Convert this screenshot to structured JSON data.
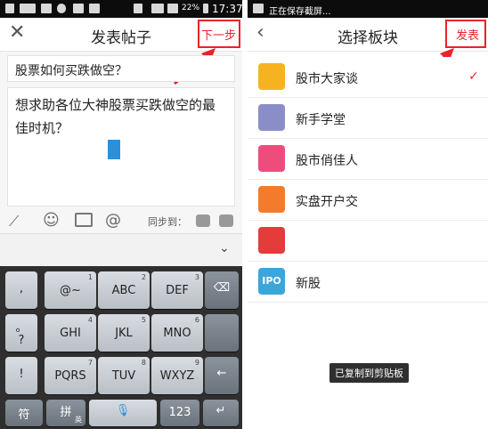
{
  "left": {
    "status": {
      "percent": "22%",
      "time": "17:37"
    },
    "title": "发表帖子",
    "next_label": "下一步",
    "post_title": "股票如何买跌做空？",
    "post_body": "想求助各位大神股票买跌做空的最佳时机？",
    "toolbar": {
      "sync_label": "同步到："
    },
    "keyboard": {
      "row1": [
        ",",
        "@~",
        "ABC",
        "DEF"
      ],
      "row1_nums": [
        "",
        "1",
        "2",
        "3"
      ],
      "row2": [
        "。",
        "GHI",
        "JKL",
        "MNO"
      ],
      "row2_nums": [
        "",
        "4",
        "5",
        "6"
      ],
      "row3": [
        "!",
        "PQRS",
        "TUV",
        "WXYZ"
      ],
      "row3_nums": [
        "",
        "7",
        "8",
        "9"
      ],
      "question": "?",
      "symbol_key": "符",
      "pinyin_key": "拼",
      "pinyin_sub": "英",
      "num_key": "123"
    }
  },
  "right": {
    "status_text": "正在保存截屏...",
    "title": "选择板块",
    "publish_label": "发表",
    "boards": [
      {
        "name": "股市大家谈",
        "color": "#f5b41f",
        "selected": true
      },
      {
        "name": "新手学堂",
        "color": "#8a8ec8",
        "selected": false
      },
      {
        "name": "股市俏佳人",
        "color": "#ef4c7e",
        "selected": false
      },
      {
        "name": "实盘开户交",
        "color": "#f57b2c",
        "selected": false
      },
      {
        "name": "",
        "color": "#e43b3b",
        "selected": false
      },
      {
        "name": "新股",
        "color": "#3ba6d9",
        "selected": false
      }
    ],
    "ipo_label": "IPO",
    "check": "✓",
    "toast": "已复制到剪贴板"
  },
  "colors": {
    "highlight": "#e8232a"
  }
}
